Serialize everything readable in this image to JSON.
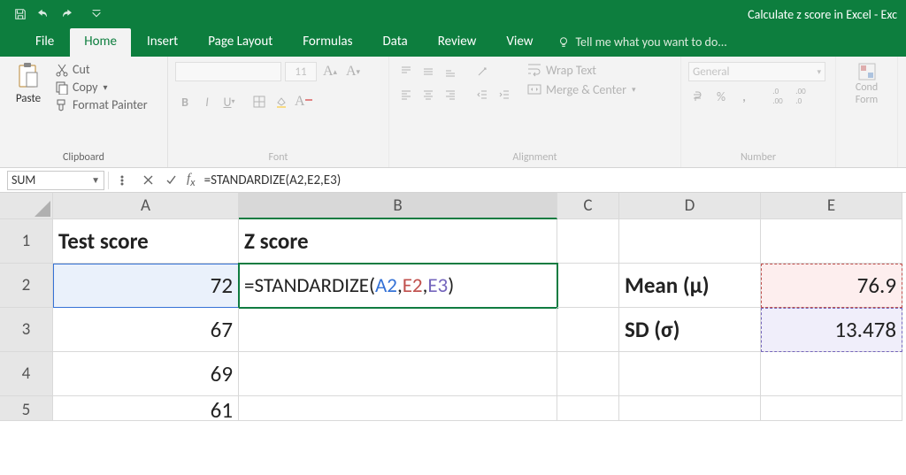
{
  "window": {
    "title": "Calculate z score in Excel - Exc"
  },
  "tabs": {
    "file": "File",
    "home": "Home",
    "insert": "Insert",
    "pagelayout": "Page Layout",
    "formulas": "Formulas",
    "data": "Data",
    "review": "Review",
    "view": "View",
    "tellme": "Tell me what you want to do..."
  },
  "ribbon": {
    "paste": "Paste",
    "cut": "Cut",
    "copy": "Copy",
    "fpainter": "Format Painter",
    "clipboard_label": "Clipboard",
    "font_name": "",
    "font_size": "11",
    "font_label": "Font",
    "wrap": "Wrap Text",
    "merge": "Merge & Center",
    "alignment_label": "Alignment",
    "number_format": "General",
    "number_label": "Number",
    "cond": "Cond",
    "form": "Form"
  },
  "formula_bar": {
    "name_box": "SUM",
    "formula": "=STANDARDIZE(A2,E2,E3)"
  },
  "columns": [
    "A",
    "B",
    "C",
    "D",
    "E"
  ],
  "rows": [
    "1",
    "2",
    "3",
    "4",
    "5"
  ],
  "cells": {
    "A1": "Test score",
    "B1": "Z score",
    "A2": "72",
    "B2_prefix": "=STANDARDIZE(",
    "B2_a2": "A2",
    "B2_c1": ",",
    "B2_e2": "E2",
    "B2_c2": ",",
    "B2_e3": "E3",
    "B2_suffix": ")",
    "D2": "Mean (μ)",
    "E2": "76.9",
    "A3": "67",
    "D3": "SD (σ)",
    "E3": "13.478",
    "A4": "69",
    "A5": "61"
  }
}
